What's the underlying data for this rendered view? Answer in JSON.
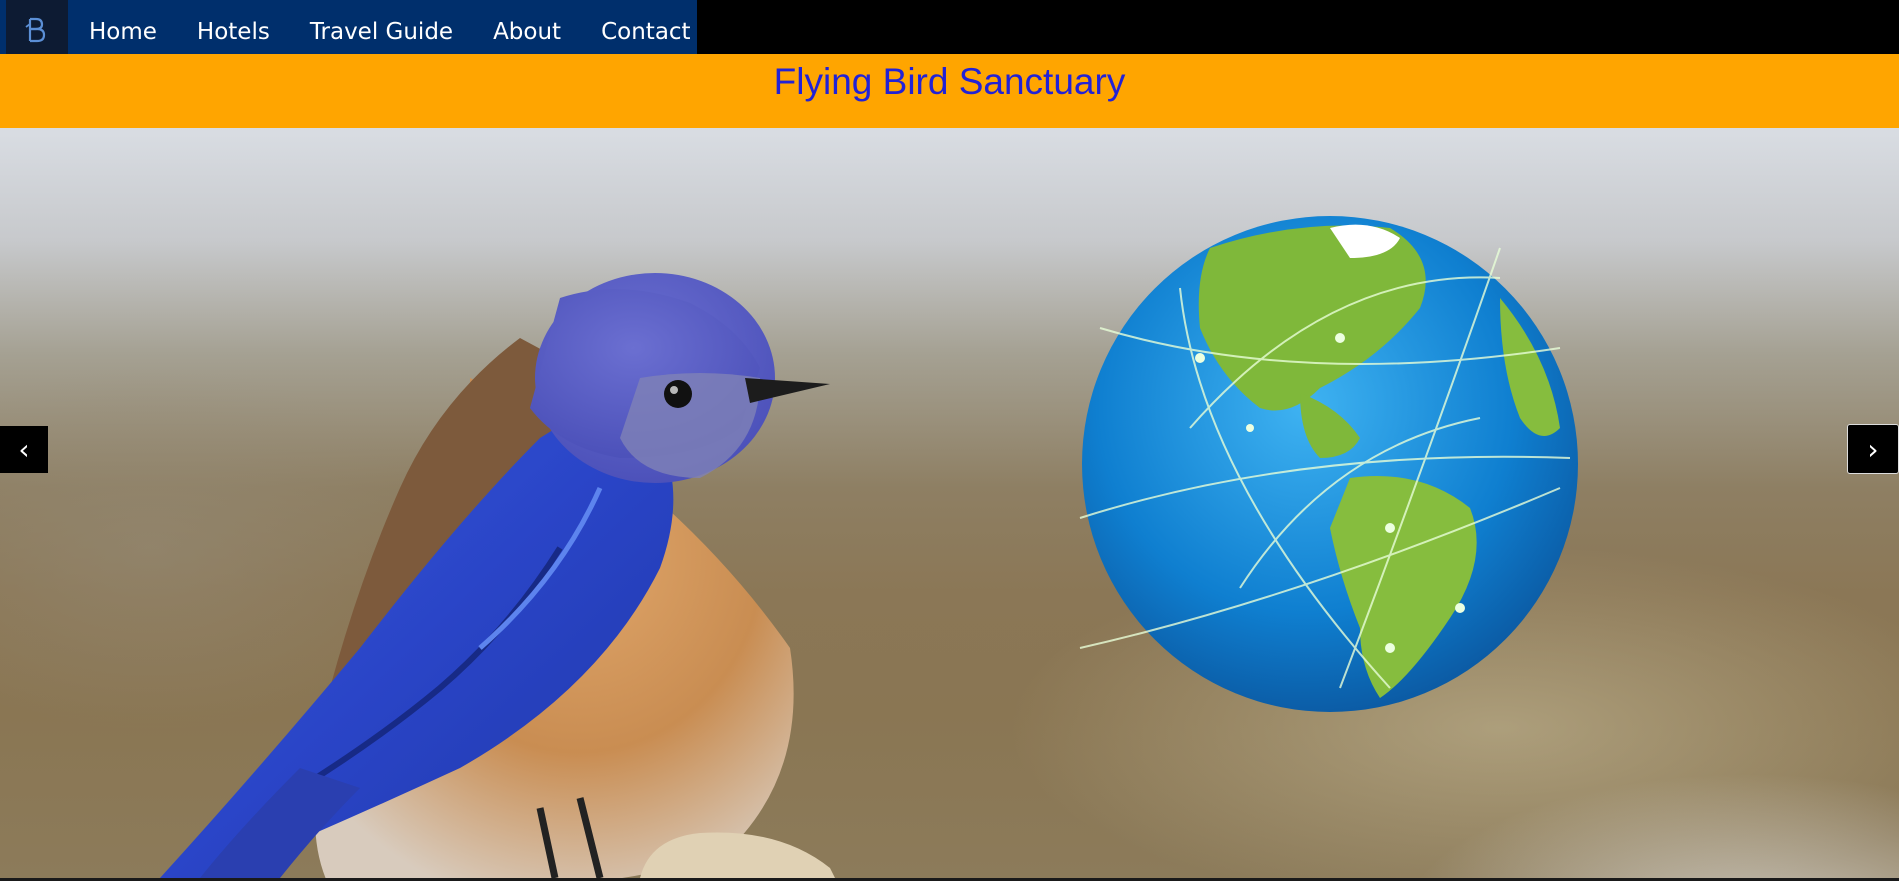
{
  "nav": {
    "logo_icon": "bird-logo-icon",
    "items": [
      {
        "label": "Home"
      },
      {
        "label": "Hotels"
      },
      {
        "label": "Travel Guide"
      },
      {
        "label": "About"
      },
      {
        "label": "Contact"
      }
    ]
  },
  "banner": {
    "title": "Flying Bird Sanctuary"
  },
  "carousel": {
    "prev_label": "‹",
    "next_label": "›",
    "slide_images": [
      "bluebird-photo",
      "globe-network-image"
    ]
  },
  "colors": {
    "nav_bg": "#002f6c",
    "banner_bg": "#ffa500",
    "title_color": "#2222d6"
  }
}
